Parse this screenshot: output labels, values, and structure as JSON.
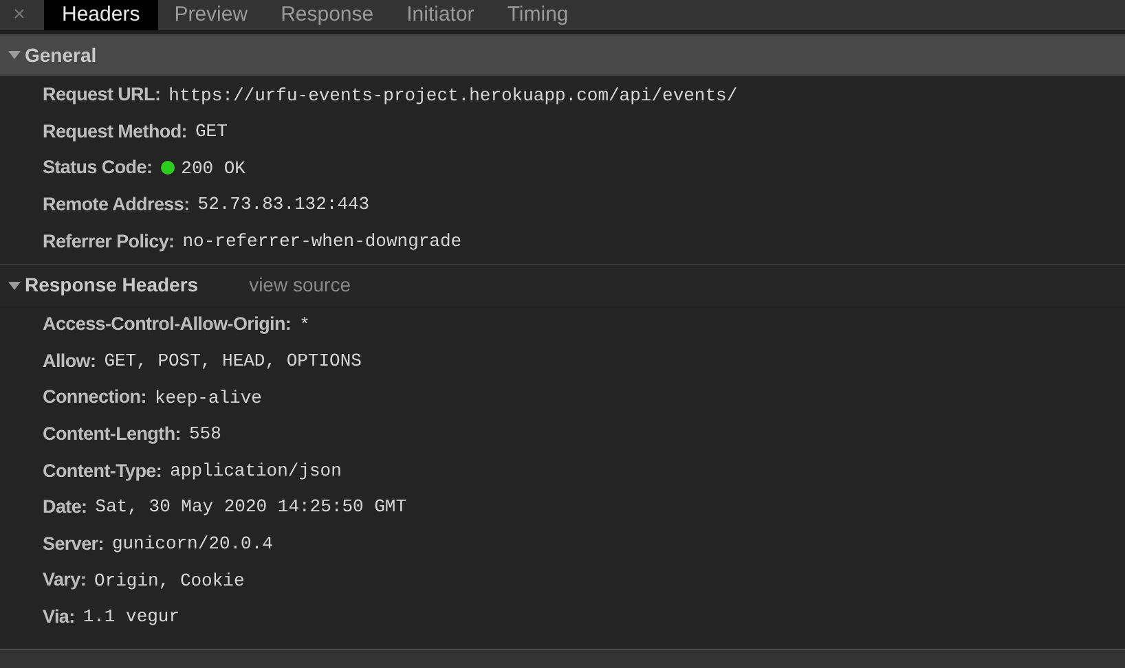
{
  "close_glyph": "×",
  "tabs": [
    {
      "label": "Headers",
      "selected": true
    },
    {
      "label": "Preview",
      "selected": false
    },
    {
      "label": "Response",
      "selected": false
    },
    {
      "label": "Initiator",
      "selected": false
    },
    {
      "label": "Timing",
      "selected": false
    }
  ],
  "sections": [
    {
      "title": "General",
      "expanded": true,
      "highlighted": true,
      "items": [
        {
          "name": "Request URL:",
          "value": "https://urfu-events-project.herokuapp.com/api/events/"
        },
        {
          "name": "Request Method:",
          "value": "GET"
        },
        {
          "name": "Status Code:",
          "value": "200 OK",
          "color": "#2ecc1f"
        },
        {
          "name": "Remote Address:",
          "value": "52.73.83.132:443"
        },
        {
          "name": "Referrer Policy:",
          "value": "no-referrer-when-downgrade"
        }
      ]
    },
    {
      "title": "Response Headers",
      "expanded": true,
      "highlighted": false,
      "link": "view source",
      "items": [
        {
          "name": "Access-Control-Allow-Origin:",
          "value": "*"
        },
        {
          "name": "Allow:",
          "value": "GET, POST, HEAD, OPTIONS"
        },
        {
          "name": "Connection:",
          "value": "keep-alive"
        },
        {
          "name": "Content-Length:",
          "value": "558"
        },
        {
          "name": "Content-Type:",
          "value": "application/json"
        },
        {
          "name": "Date:",
          "value": "Sat, 30 May 2020 14:25:50 GMT"
        },
        {
          "name": "Server:",
          "value": "gunicorn/20.0.4"
        },
        {
          "name": "Vary:",
          "value": "Origin, Cookie"
        },
        {
          "name": "Via:",
          "value": "1.1 vegur"
        }
      ]
    }
  ]
}
